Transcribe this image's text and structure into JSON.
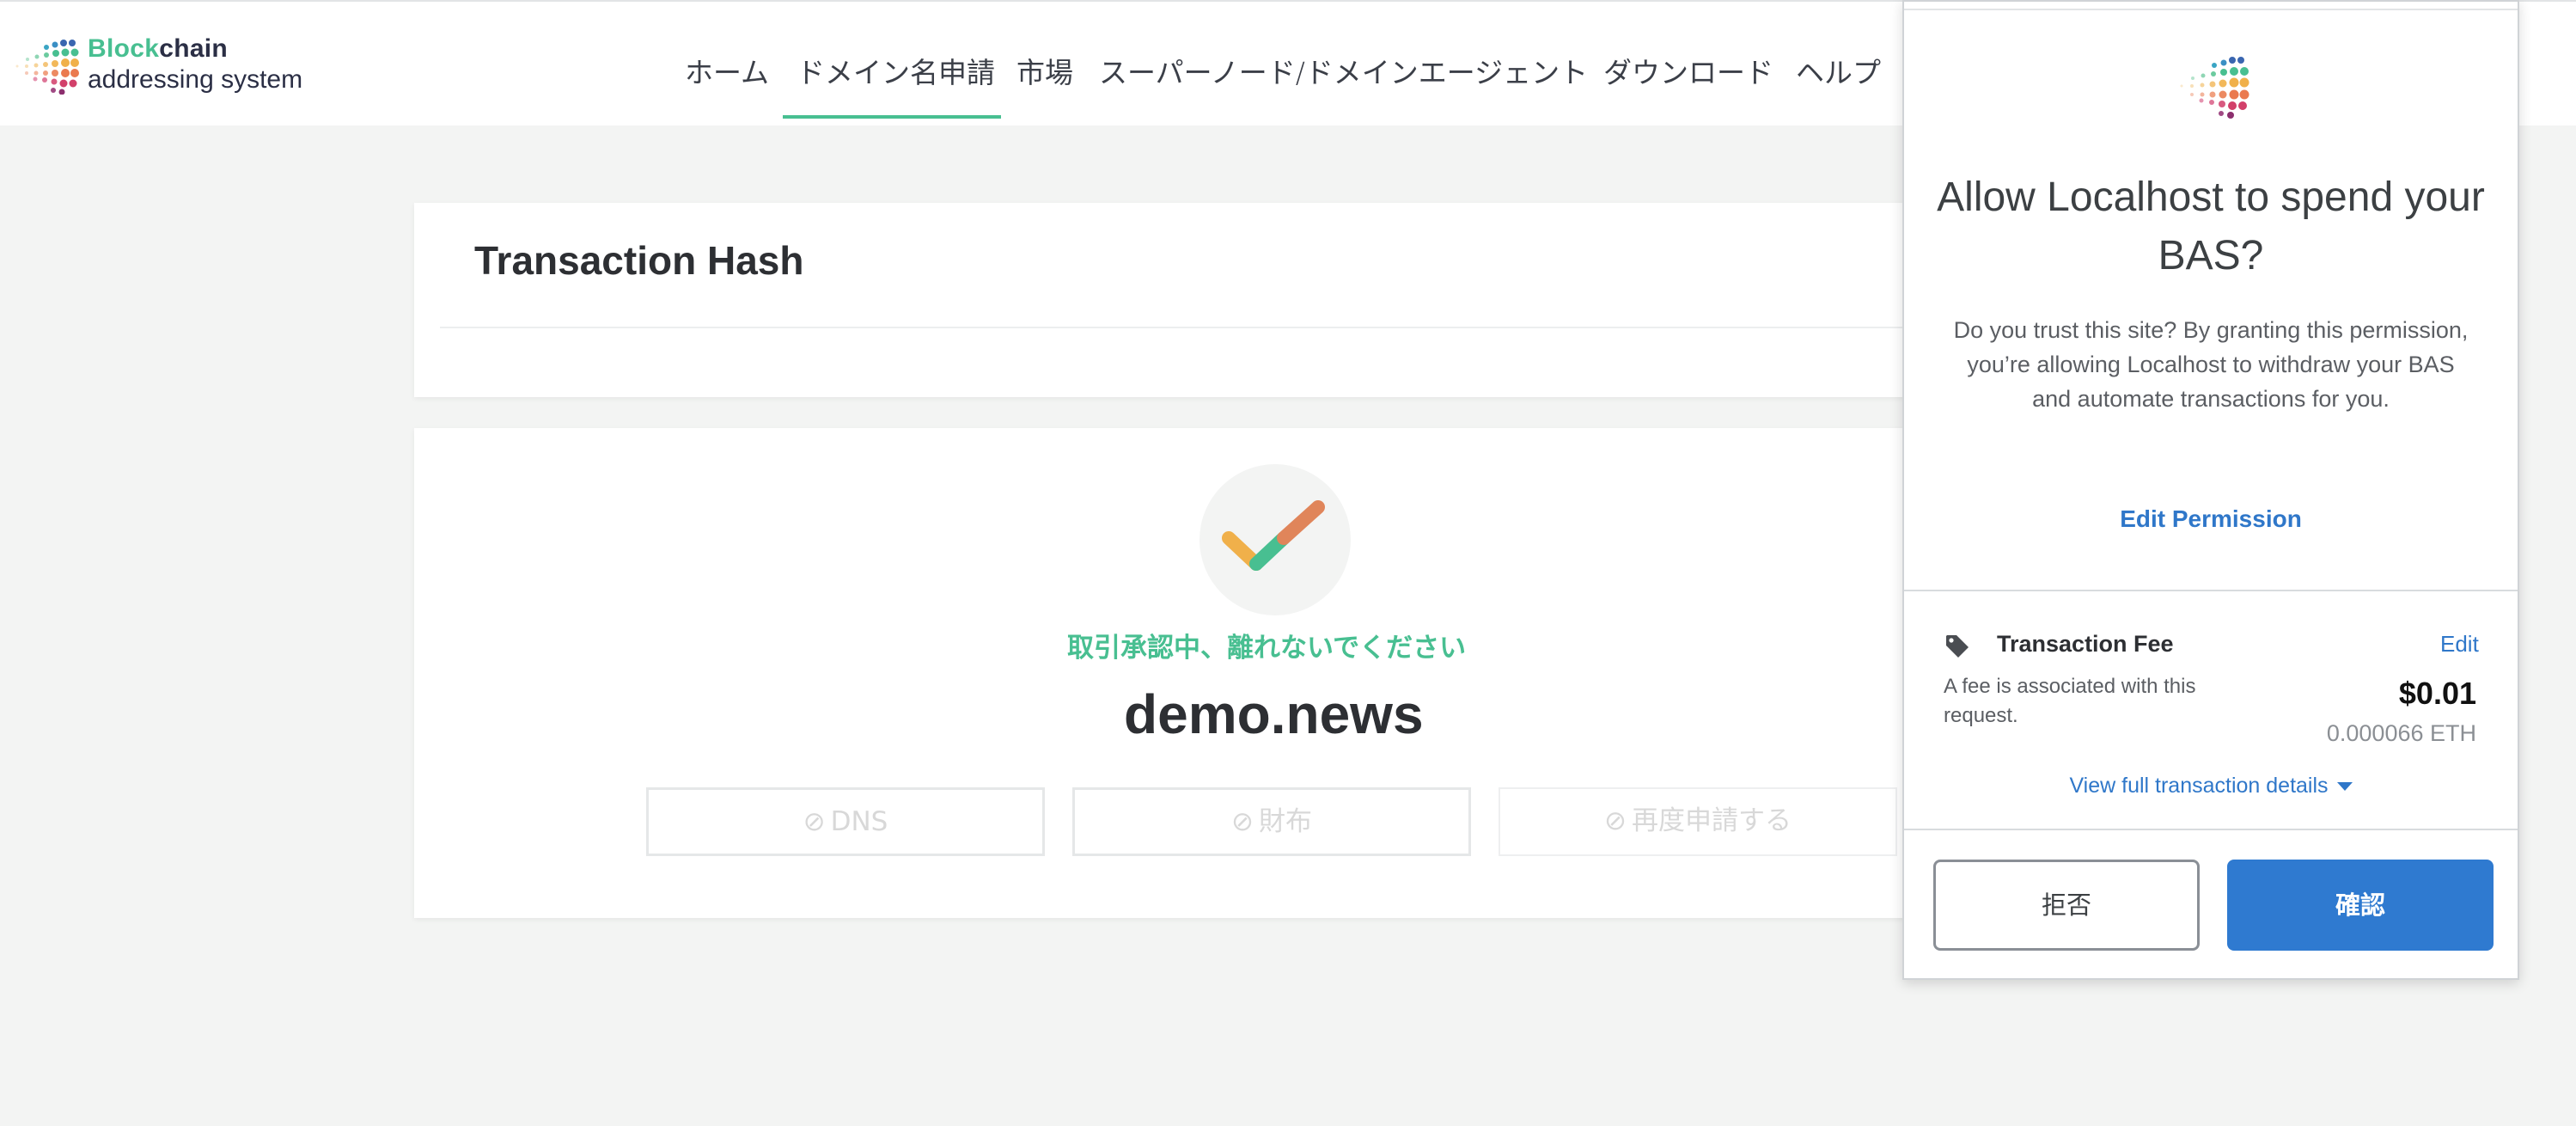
{
  "logo": {
    "name_part1": "Block",
    "name_part2": "chain",
    "name_line2": "addressing system",
    "icon": "dotted-fan-logo-icon"
  },
  "nav": {
    "items": [
      {
        "label": "ホーム"
      },
      {
        "label": "ドメイン名申請",
        "active": true
      },
      {
        "label": "市場"
      },
      {
        "label": "スーパーノード/ドメインエージェント"
      },
      {
        "label": "ダウンロード"
      },
      {
        "label": "ヘルプ"
      }
    ]
  },
  "transaction": {
    "title": "Transaction Hash"
  },
  "result": {
    "status": "取引承認中、離れないでください",
    "domain": "demo.news",
    "buttons": [
      {
        "label": "DNS",
        "icon": "ban-icon"
      },
      {
        "label": "財布",
        "icon": "ban-icon"
      },
      {
        "label": "再度申請する",
        "icon": "ban-icon"
      }
    ]
  },
  "popup": {
    "title": "Allow Localhost to spend your BAS?",
    "description": "Do you trust this site? By granting this permission, you’re allowing Localhost to withdraw your BAS and automate transactions for you.",
    "edit_permission": "Edit Permission",
    "fee": {
      "label": "Transaction Fee",
      "edit": "Edit",
      "description": "A fee is associated with this request.",
      "usd": "$0.01",
      "eth": "0.000066 ETH"
    },
    "view_details": "View full transaction details",
    "reject": "拒否",
    "confirm": "確認"
  },
  "colors": {
    "accent_green": "#48bf91",
    "link_blue": "#2f77c9",
    "confirm_blue": "#2f7ad0",
    "background": "#f3f4f3"
  }
}
